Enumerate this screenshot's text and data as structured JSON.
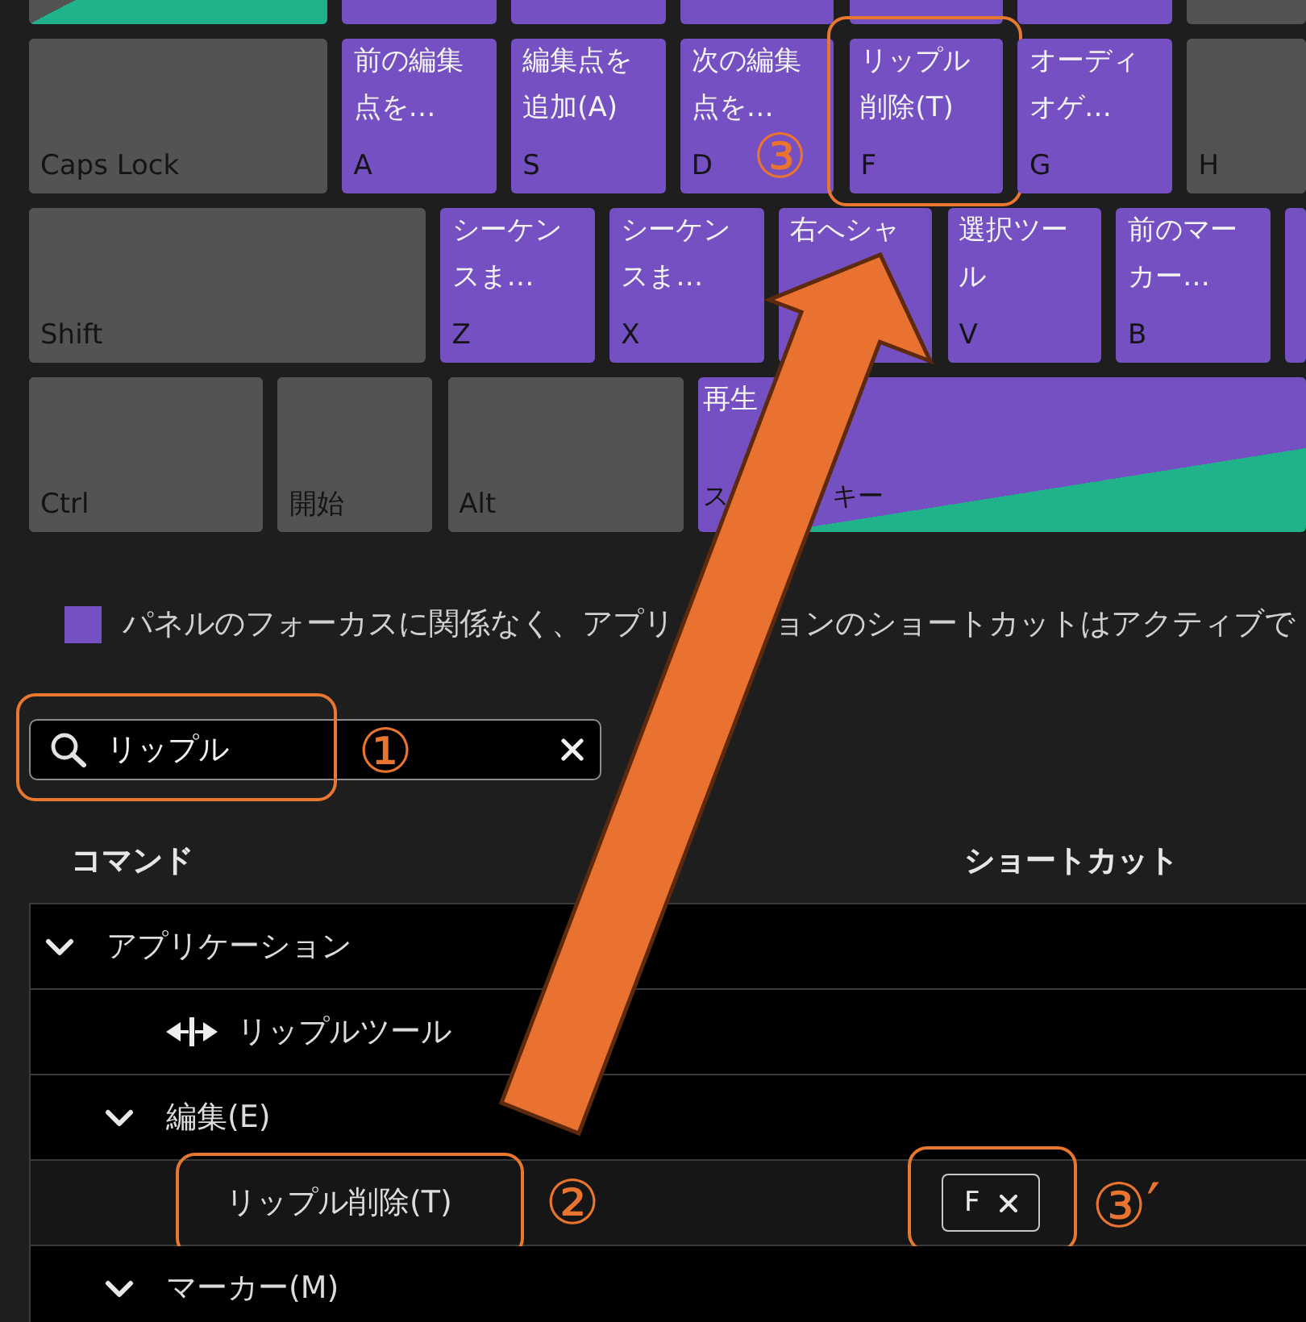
{
  "keyboard": {
    "rows": [
      {
        "keys": [
          {
            "kind": "unassigned",
            "panel_shortcut": true
          },
          {
            "kind": "application",
            "panel_shortcut": false
          },
          {
            "kind": "application",
            "panel_shortcut": false
          },
          {
            "kind": "application",
            "panel_shortcut": false
          },
          {
            "kind": "application",
            "panel_shortcut": false
          },
          {
            "kind": "application",
            "panel_shortcut": false
          },
          {
            "kind": "unassigned",
            "panel_shortcut": false
          }
        ]
      },
      {
        "keys": [
          {
            "kind": "unassigned",
            "panel_shortcut": false,
            "key": "Caps Lock"
          },
          {
            "kind": "application",
            "panel_shortcut": false,
            "label_lines": [
              "前の編集",
              "点を…"
            ],
            "key": "A"
          },
          {
            "kind": "application",
            "panel_shortcut": false,
            "label_lines": [
              "編集点を",
              "追加(A)"
            ],
            "key": "S"
          },
          {
            "kind": "application",
            "panel_shortcut": false,
            "label_lines": [
              "次の編集",
              "点を…"
            ],
            "key": "D"
          },
          {
            "kind": "application",
            "panel_shortcut": false,
            "label_lines": [
              "リップル",
              "削除(T)"
            ],
            "key": "F",
            "callout": "③"
          },
          {
            "kind": "application",
            "panel_shortcut": false,
            "label_lines": [
              "オーディ",
              "オゲ…"
            ],
            "key": "G"
          },
          {
            "kind": "unassigned",
            "panel_shortcut": false,
            "key": "H"
          }
        ]
      },
      {
        "keys": [
          {
            "kind": "unassigned",
            "panel_shortcut": false,
            "key": "Shift"
          },
          {
            "kind": "application",
            "panel_shortcut": false,
            "label_lines": [
              "シーケン",
              "スま…"
            ],
            "key": "Z"
          },
          {
            "kind": "application",
            "panel_shortcut": false,
            "label_lines": [
              "シーケン",
              "スま…"
            ],
            "key": "X"
          },
          {
            "kind": "application",
            "panel_shortcut": false,
            "label_lines": [
              "右へシャ"
            ]
          },
          {
            "kind": "application",
            "panel_shortcut": false,
            "label_lines": [
              "選択ツー",
              "ル"
            ],
            "key": "V"
          },
          {
            "kind": "application",
            "panel_shortcut": false,
            "label_lines": [
              "前のマー",
              "カー…"
            ],
            "key": "B"
          },
          {
            "kind": "application"
          }
        ]
      },
      {
        "keys": [
          {
            "kind": "unassigned",
            "panel_shortcut": false,
            "key": "Ctrl"
          },
          {
            "kind": "unassigned",
            "panel_shortcut": false,
            "key": "開始"
          },
          {
            "kind": "unassigned",
            "panel_shortcut": false,
            "key": "Alt"
          },
          {
            "kind": "application",
            "panel_shortcut": true,
            "label_lines": [
              "再生"
            ],
            "key_parts": [
              "ス",
              "キー"
            ]
          }
        ]
      }
    ]
  },
  "legend": {
    "kind": "application",
    "text_parts": [
      "パネルのフォーカスに関係なく、アプリ",
      "ョンのショートカットはアクティブで"
    ]
  },
  "search": {
    "value": "リップル",
    "callout": "①"
  },
  "commands": {
    "columns": [
      "コマンド",
      "ショートカット"
    ],
    "items": [
      {
        "kind": "group",
        "label": "アプリケーション",
        "expanded": true,
        "selected": false,
        "children": [
          {
            "kind": "tool",
            "label": "リップルツール",
            "selected": false
          },
          {
            "kind": "group",
            "label": "編集(E)",
            "expanded": true,
            "selected": false,
            "children": [
              {
                "kind": "command",
                "label": "リップル削除(T)",
                "selected": true,
                "callout": "②",
                "shortcuts": [
                  {
                    "key": "F",
                    "callout": "③′"
                  }
                ]
              }
            ]
          },
          {
            "kind": "group",
            "label": "マーカー(M)",
            "expanded": true,
            "selected": false
          }
        ]
      }
    ]
  }
}
